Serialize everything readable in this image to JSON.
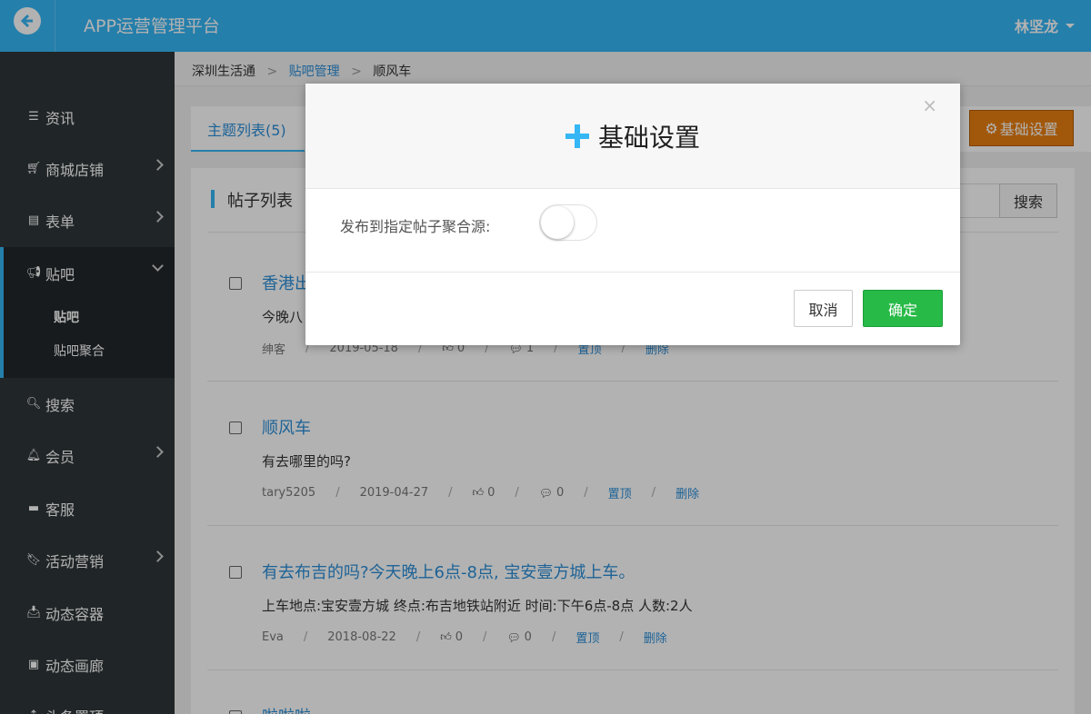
{
  "header": {
    "app_title": "APP运营管理平台",
    "user_name": "林坚龙"
  },
  "sidebar": {
    "items": [
      {
        "label": "资讯",
        "icon": "list-icon"
      },
      {
        "label": "商城店铺",
        "icon": "cart-icon"
      },
      {
        "label": "表单",
        "icon": "form-icon"
      },
      {
        "label": "贴吧",
        "icon": "bullhorn-icon"
      },
      {
        "label": "搜索",
        "icon": "search-icon"
      },
      {
        "label": "会员",
        "icon": "bell-icon"
      },
      {
        "label": "客服",
        "icon": "comment-icon"
      },
      {
        "label": "活动营销",
        "icon": "bookmark-icon"
      },
      {
        "label": "动态容器",
        "icon": "inbox-icon"
      },
      {
        "label": "动态画廊",
        "icon": "picture-icon"
      },
      {
        "label": "头条置顶",
        "icon": "arrow-up-icon"
      }
    ],
    "sub_items": [
      "贴吧",
      "贴吧聚合"
    ]
  },
  "breadcrumb": {
    "home": "深圳生活通",
    "sep": ">",
    "section": "贴吧管理",
    "current": "顺风车"
  },
  "tabs": {
    "active_label": "主题列表(5)"
  },
  "toolbar": {
    "settings_label": "基础设置"
  },
  "panel": {
    "title": "帖子列表",
    "search_label": "搜索"
  },
  "posts": [
    {
      "title": "香港出",
      "content": "今晚八",
      "author": "绅客",
      "date": "2019-05-18",
      "likes": "0",
      "comments": "1",
      "pin": "置顶",
      "delete": "删除"
    },
    {
      "title": "顺风车",
      "content": "有去哪里的吗?",
      "author": "tary5205",
      "date": "2019-04-27",
      "likes": "0",
      "comments": "0",
      "pin": "置顶",
      "delete": "删除"
    },
    {
      "title": "有去布吉的吗?今天晚上6点-8点, 宝安壹方城上车。",
      "content": "上车地点:宝安壹方城 终点:布吉地铁站附近 时间:下午6点-8点 人数:2人",
      "author": "Eva",
      "date": "2018-08-22",
      "likes": "0",
      "comments": "0",
      "pin": "置顶",
      "delete": "删除"
    },
    {
      "title": "啦啦啦",
      "content": "",
      "author": "",
      "date": "",
      "likes": "",
      "comments": "",
      "pin": "",
      "delete": ""
    }
  ],
  "meta_sep": "/",
  "modal": {
    "title": "基础设置",
    "close": "×",
    "field_label": "发布到指定帖子聚合源:",
    "toggle_on": false,
    "cancel_label": "取消",
    "ok_label": "确定"
  },
  "colors": {
    "primary": "#35b6f5",
    "sidebar": "#2f3538",
    "orange": "#e87e10",
    "green": "#27ba47"
  }
}
